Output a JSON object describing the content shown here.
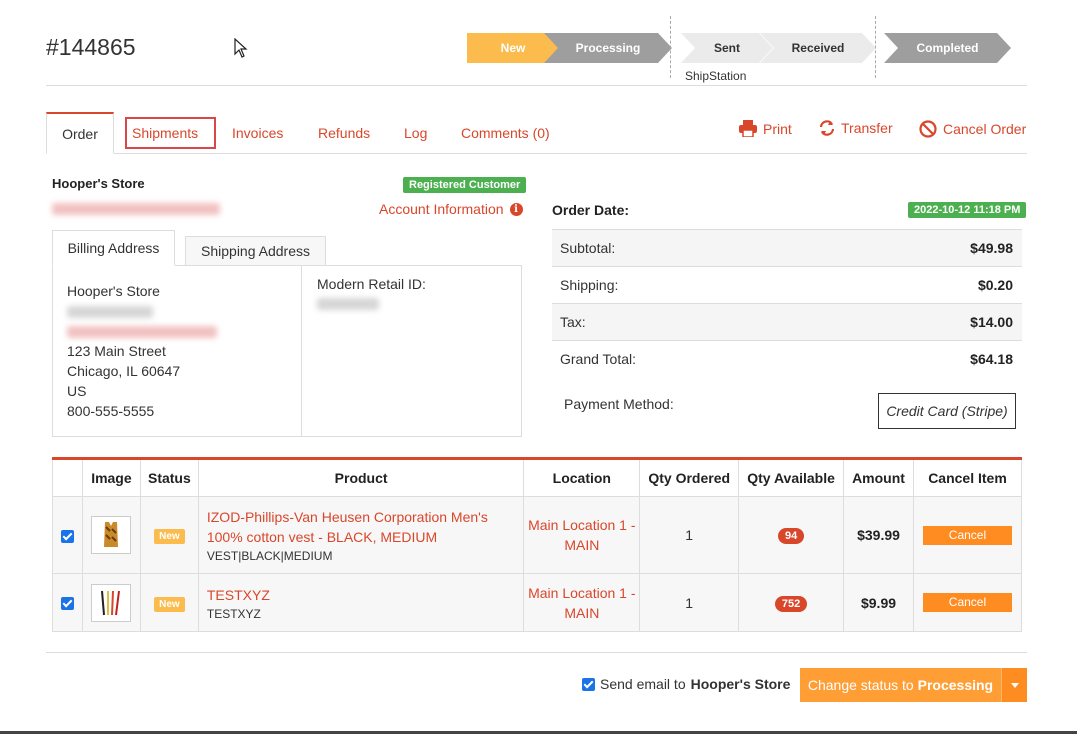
{
  "order": {
    "number": "#144865"
  },
  "progress": {
    "steps": [
      "New",
      "Processing",
      "Sent",
      "Received",
      "Completed"
    ],
    "active": "New",
    "sub_label": "ShipStation"
  },
  "tabs": [
    "Order",
    "Shipments",
    "Invoices",
    "Refunds",
    "Log",
    "Comments (0)"
  ],
  "actions": {
    "print": "Print",
    "transfer": "Transfer",
    "cancel_order": "Cancel Order"
  },
  "customer": {
    "store_name": "Hooper's Store",
    "badge": "Registered Customer",
    "account_info": "Account Information"
  },
  "address": {
    "tabs": [
      "Billing Address",
      "Shipping Address"
    ],
    "name": "Hooper's Store",
    "street": "123 Main Street",
    "city": "Chicago, IL 60647",
    "country": "US",
    "phone": "800-555-5555",
    "modern_retail_label": "Modern Retail ID:"
  },
  "totals": {
    "order_date_label": "Order Date:",
    "order_date": "2022-10-12 11:18 PM",
    "rows": [
      {
        "label": "Subtotal:",
        "value": "$49.98"
      },
      {
        "label": "Shipping:",
        "value": "$0.20"
      },
      {
        "label": "Tax:",
        "value": "$14.00"
      },
      {
        "label": "Grand Total:",
        "value": "$64.18"
      }
    ],
    "payment_method_label": "Payment Method:",
    "payment_method": "Credit Card (Stripe)"
  },
  "items_table": {
    "headers": [
      "Image",
      "Status",
      "Product",
      "Location",
      "Qty Ordered",
      "Qty Available",
      "Amount",
      "Cancel Item"
    ],
    "rows": [
      {
        "checked": true,
        "status": "New",
        "product_name": "IZOD-Phillips-Van Heusen Corporation Men's 100% cotton vest - BLACK, MEDIUM",
        "sku": "VEST|BLACK|MEDIUM",
        "location": "Main Location 1 - MAIN",
        "qty_ordered": "1",
        "qty_available": "94",
        "amount": "$39.99",
        "cancel": "Cancel"
      },
      {
        "checked": true,
        "status": "New",
        "product_name": "TESTXYZ",
        "sku": "TESTXYZ",
        "location": "Main Location 1 - MAIN",
        "qty_ordered": "1",
        "qty_available": "752",
        "amount": "$9.99",
        "cancel": "Cancel"
      }
    ]
  },
  "footer": {
    "send_email_prefix": "Send email to",
    "send_email_target": "Hooper's Store",
    "change_status_prefix": "Change status to",
    "change_status_target": "Processing"
  }
}
